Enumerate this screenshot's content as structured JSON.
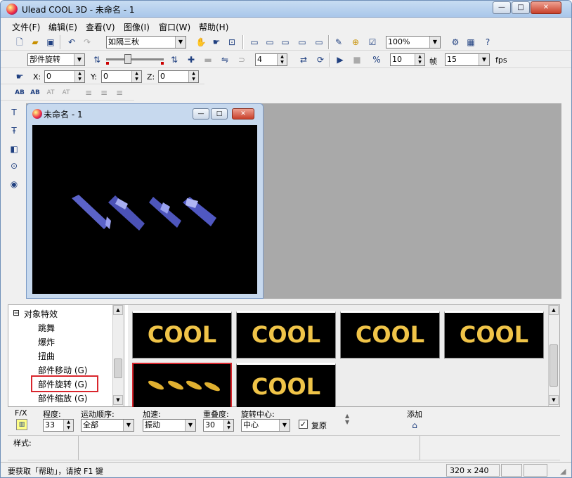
{
  "window": {
    "title": "Ulead COOL 3D - 未命名 - 1",
    "min": "—",
    "max": "□",
    "close": "✕"
  },
  "menu": [
    "文件(F)",
    "编辑(E)",
    "查看(V)",
    "图像(I)",
    "窗口(W)",
    "帮助(H)"
  ],
  "toolbar1": {
    "preset": "如隔三秋",
    "zoom": "100%"
  },
  "toolbar2": {
    "effect": "部件旋转",
    "frame_value": "4",
    "frame_count": "10",
    "frame_label": "帧",
    "fps_value": "15",
    "fps_label": "fps"
  },
  "toolbar3": {
    "x_label": "X:",
    "x": "0",
    "y_label": "Y:",
    "y": "0",
    "z_label": "Z:",
    "z": "0"
  },
  "toolbar4": {
    "b1": "AB",
    "b2": "AB",
    "b3": "AT",
    "b4": "AT"
  },
  "doc": {
    "title": "未命名 - 1"
  },
  "tree": {
    "root": "对象特效",
    "items": [
      "跳舞",
      "爆炸",
      "扭曲",
      "部件移动 (G)",
      "部件旋转 (G)",
      "部件缩放 (G)"
    ],
    "selected": "部件旋转 (G)"
  },
  "thumbs": [
    "COOL",
    "COOL",
    "COOL",
    "COOL",
    "COOL"
  ],
  "props": {
    "fx_label": "F/X",
    "degree_label": "程度:",
    "degree": "33",
    "order_label": "运动顺序:",
    "order": "全部",
    "accel_label": "加速:",
    "accel": "振动",
    "overlap_label": "重叠度:",
    "overlap": "30",
    "center_label": "旋转中心:",
    "center": "中心",
    "reset_label": "复原",
    "add_label": "添加"
  },
  "style": {
    "label": "样式:"
  },
  "status": {
    "help": "要获取「帮助」，请按 F1 键",
    "size": "320 x 240"
  },
  "colors": {
    "highlight": "#d9262d",
    "cool_gold": "#f0c448"
  }
}
